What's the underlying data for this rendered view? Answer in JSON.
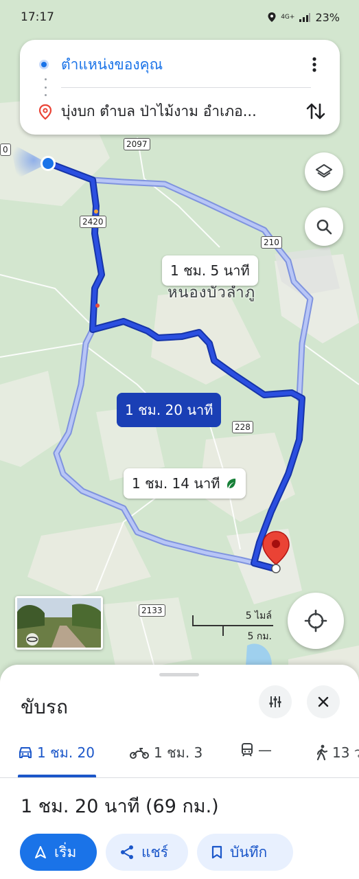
{
  "status_bar": {
    "time": "17:17",
    "network": "4G+",
    "battery": "23%"
  },
  "search_card": {
    "origin": "ตำแหน่งของคุณ",
    "destination": "บุ่งบก ตำบล ป่าไม้งาม อำเภอ..."
  },
  "map": {
    "route_labels": {
      "alt1": "1 ชม. 5 นาที",
      "main": "1 ชม. 20 นาที",
      "alt2": "1 ชม. 14 นาที"
    },
    "place_name": "หนองบัวลำภู",
    "road_shields": [
      "2097",
      "2420",
      "210",
      "228",
      "2133"
    ],
    "scale": {
      "miles": "5 ไมล์",
      "km": "5 กม."
    },
    "colors": {
      "main_route": "#1a3fd0",
      "alt_route": "#a6b8f4",
      "destination_pin": "#ea4335"
    }
  },
  "bottom_sheet": {
    "mode_title": "ขับรถ",
    "tabs": [
      {
        "icon": "car-icon",
        "label": "1 ชม. 20"
      },
      {
        "icon": "motorcycle-icon",
        "label": "1 ชม. 3"
      },
      {
        "icon": "transit-icon",
        "label": "—"
      },
      {
        "icon": "walk-icon",
        "label": "13 ว"
      }
    ],
    "summary": "1 ชม. 20 นาที (69 กม.)",
    "actions": {
      "start": "เริ่ม",
      "share": "แชร์",
      "save": "บันทึก"
    }
  }
}
